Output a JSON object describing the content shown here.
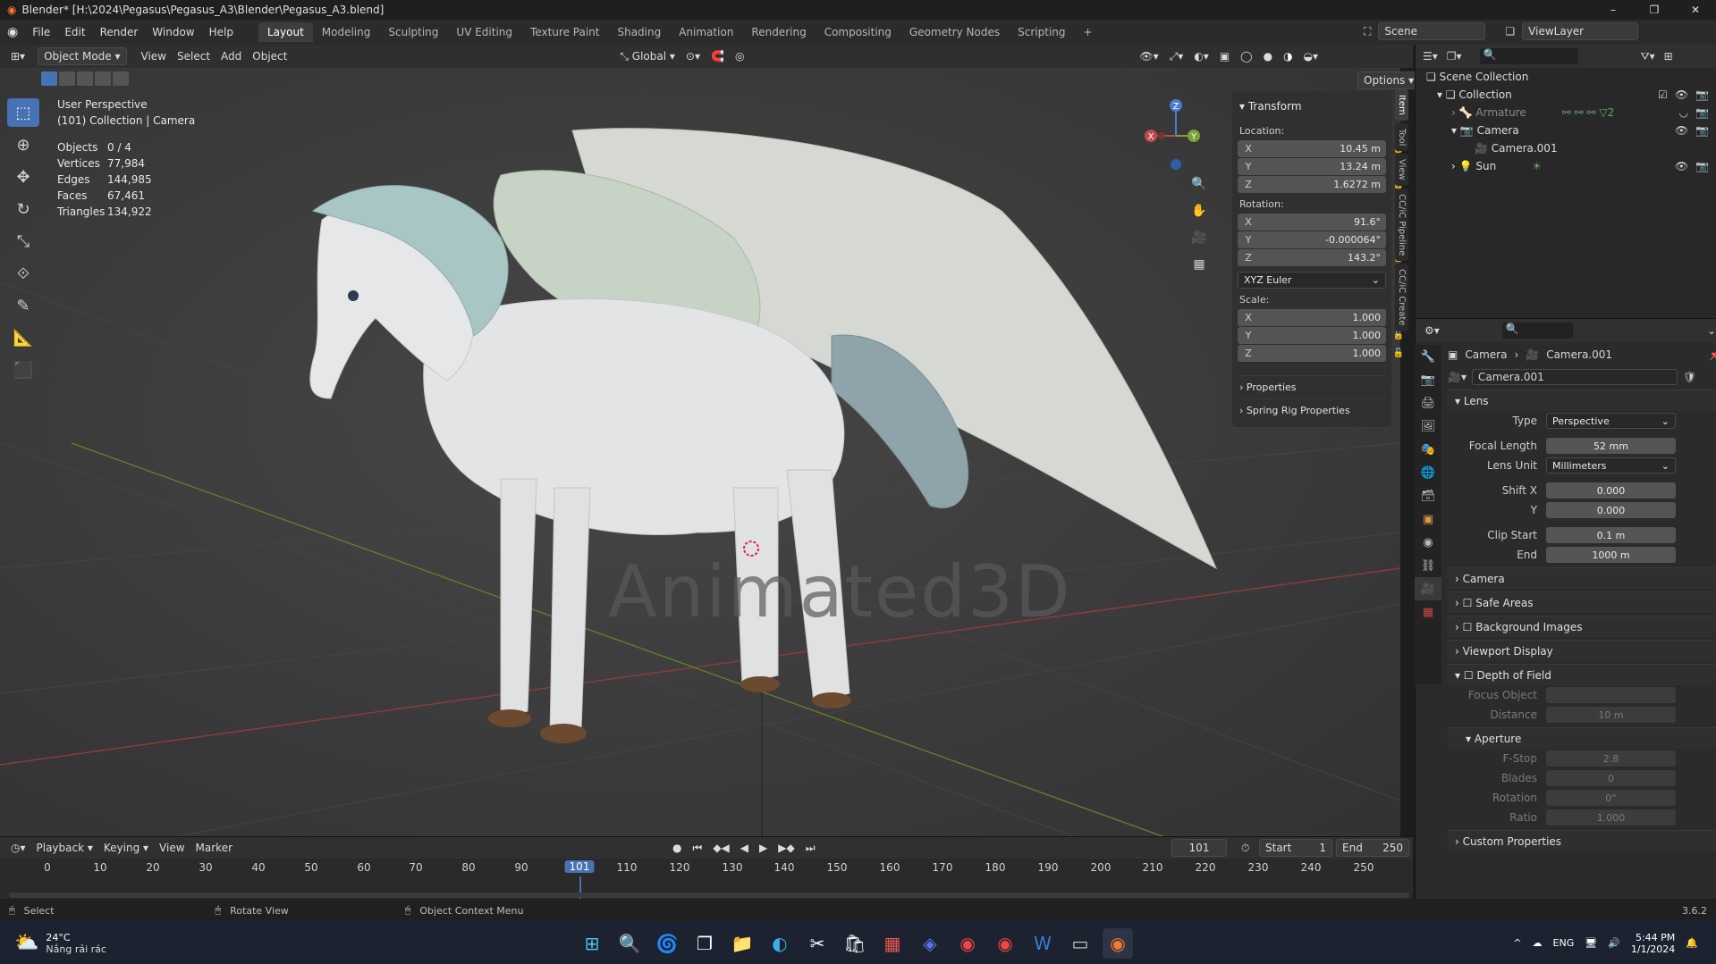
{
  "window": {
    "title": "Blender* [H:\\2024\\Pegasus\\Pegasus_A3\\Blender\\Pegasus_A3.blend]",
    "min": "–",
    "max": "❐",
    "close": "✕"
  },
  "menu": [
    "File",
    "Edit",
    "Render",
    "Window",
    "Help"
  ],
  "workspaces": [
    "Layout",
    "Modeling",
    "Sculpting",
    "UV Editing",
    "Texture Paint",
    "Shading",
    "Animation",
    "Rendering",
    "Compositing",
    "Geometry Nodes",
    "Scripting"
  ],
  "workspace_add": "+",
  "scene": {
    "scene_name": "Scene",
    "view_layer": "ViewLayer"
  },
  "viewport_header": {
    "mode": "Object Mode",
    "menus": [
      "View",
      "Select",
      "Add",
      "Object"
    ],
    "orientation": "Global",
    "options": "Options"
  },
  "viewport": {
    "perspective": "User Perspective",
    "collection_info": "(101) Collection | Camera",
    "stats": [
      {
        "k": "Objects",
        "v": "0 / 4"
      },
      {
        "k": "Vertices",
        "v": "77,984"
      },
      {
        "k": "Edges",
        "v": "144,985"
      },
      {
        "k": "Faces",
        "v": "67,461"
      },
      {
        "k": "Triangles",
        "v": "134,922"
      }
    ],
    "watermark": "Animated3D",
    "gizmo": {
      "x": "X",
      "y": "Y",
      "z": "Z"
    }
  },
  "n_panel": {
    "title": "Transform",
    "location_label": "Location:",
    "location": [
      {
        "ax": "X",
        "v": "10.45 m"
      },
      {
        "ax": "Y",
        "v": "13.24 m"
      },
      {
        "ax": "Z",
        "v": "1.6272 m"
      }
    ],
    "rotation_label": "Rotation:",
    "rotation": [
      {
        "ax": "X",
        "v": "91.6°"
      },
      {
        "ax": "Y",
        "v": "-0.000064°"
      },
      {
        "ax": "Z",
        "v": "143.2°"
      }
    ],
    "rotation_mode": "XYZ Euler",
    "scale_label": "Scale:",
    "scale": [
      {
        "ax": "X",
        "v": "1.000"
      },
      {
        "ax": "Y",
        "v": "1.000"
      },
      {
        "ax": "Z",
        "v": "1.000"
      }
    ],
    "collapsed": [
      "Properties",
      "Spring Rig Properties"
    ],
    "tabs": [
      "Item",
      "Tool",
      "View",
      "CC/iC Pipeline",
      "CC/iC Create"
    ]
  },
  "outliner": {
    "root": "Scene Collection",
    "items": [
      {
        "name": "Collection",
        "depth": 0
      },
      {
        "name": "Armature",
        "depth": 1
      },
      {
        "name": "Camera",
        "depth": 1
      },
      {
        "name": "Camera.001",
        "depth": 2
      },
      {
        "name": "Sun",
        "depth": 1
      }
    ],
    "armature_count": "2"
  },
  "properties": {
    "breadcrumb": [
      "Camera",
      "Camera.001"
    ],
    "datablock": "Camera.001",
    "lens_section": "Lens",
    "lens": [
      {
        "lab": "Type",
        "val": "Perspective",
        "sel": true
      },
      {
        "lab": "Focal Length",
        "val": "52 mm"
      },
      {
        "lab": "Lens Unit",
        "val": "Millimeters",
        "sel": true
      },
      {
        "lab": "Shift X",
        "val": "0.000"
      },
      {
        "lab": "Y",
        "val": "0.000"
      },
      {
        "lab": "Clip Start",
        "val": "0.1 m"
      },
      {
        "lab": "End",
        "val": "1000 m"
      }
    ],
    "sections": [
      "Camera",
      "Safe Areas",
      "Background Images",
      "Viewport Display",
      "Depth of Field"
    ],
    "dof": [
      {
        "lab": "Focus Object",
        "val": ""
      },
      {
        "lab": "Distance",
        "val": "10 m"
      }
    ],
    "aperture_section": "Aperture",
    "aperture": [
      {
        "lab": "F-Stop",
        "val": "2.8"
      },
      {
        "lab": "Blades",
        "val": "0"
      },
      {
        "lab": "Rotation",
        "val": "0°"
      },
      {
        "lab": "Ratio",
        "val": "1.000"
      }
    ],
    "custom_properties": "Custom Properties"
  },
  "timeline": {
    "menus": [
      "Playback",
      "Keying",
      "View",
      "Marker"
    ],
    "current_frame": "101",
    "start_label": "Start",
    "start": "1",
    "end_label": "End",
    "end": "250",
    "ticks": [
      "0",
      "10",
      "20",
      "30",
      "40",
      "50",
      "60",
      "70",
      "80",
      "90",
      "110",
      "120",
      "130",
      "140",
      "150",
      "160",
      "170",
      "180",
      "190",
      "200",
      "210",
      "220",
      "230",
      "240",
      "250"
    ]
  },
  "statusbar": {
    "hints": [
      "Select",
      "Rotate View",
      "Object Context Menu"
    ],
    "version": "3.6.2"
  },
  "taskbar": {
    "weather_temp": "24°C",
    "weather_desc": "Nắng rải rác",
    "lang": "ENG",
    "time": "5:44 PM",
    "date": "1/1/2024"
  }
}
